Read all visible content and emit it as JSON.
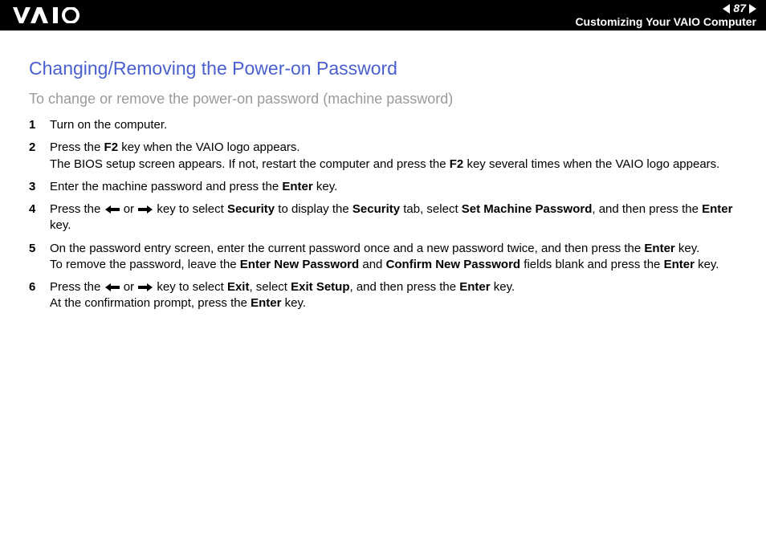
{
  "header": {
    "page_number": "87",
    "section": "Customizing Your VAIO Computer"
  },
  "page": {
    "title": "Changing/Removing the Power-on Password",
    "subtitle": "To change or remove the power-on password (machine password)"
  },
  "steps": [
    {
      "num": "1",
      "segments": [
        {
          "t": "Turn on the computer."
        }
      ]
    },
    {
      "num": "2",
      "segments": [
        {
          "t": "Press the "
        },
        {
          "b": "F2"
        },
        {
          "t": " key when the VAIO logo appears."
        },
        {
          "br": true
        },
        {
          "t": "The BIOS setup screen appears. If not, restart the computer and press the "
        },
        {
          "b": "F2"
        },
        {
          "t": " key several times when the VAIO logo appears."
        }
      ]
    },
    {
      "num": "3",
      "segments": [
        {
          "t": "Enter the machine password and press the "
        },
        {
          "b": "Enter"
        },
        {
          "t": " key."
        }
      ]
    },
    {
      "num": "4",
      "segments": [
        {
          "t": "Press the "
        },
        {
          "arrow": "left"
        },
        {
          "t": " or "
        },
        {
          "arrow": "right"
        },
        {
          "t": " key to select "
        },
        {
          "b": "Security"
        },
        {
          "t": " to display the "
        },
        {
          "b": "Security"
        },
        {
          "t": " tab, select "
        },
        {
          "b": "Set Machine Password"
        },
        {
          "t": ", and then press the "
        },
        {
          "b": "Enter"
        },
        {
          "t": " key."
        }
      ]
    },
    {
      "num": "5",
      "segments": [
        {
          "t": "On the password entry screen, enter the current password once and a new password twice, and then press the "
        },
        {
          "b": "Enter"
        },
        {
          "t": " key."
        },
        {
          "br": true
        },
        {
          "t": "To remove the password, leave the "
        },
        {
          "b": "Enter New Password"
        },
        {
          "t": " and "
        },
        {
          "b": "Confirm New Password"
        },
        {
          "t": " fields blank and press the "
        },
        {
          "b": "Enter"
        },
        {
          "t": " key."
        }
      ]
    },
    {
      "num": "6",
      "segments": [
        {
          "t": "Press the "
        },
        {
          "arrow": "left"
        },
        {
          "t": " or "
        },
        {
          "arrow": "right"
        },
        {
          "t": " key to select "
        },
        {
          "b": "Exit"
        },
        {
          "t": ", select "
        },
        {
          "b": "Exit Setup"
        },
        {
          "t": ", and then press the "
        },
        {
          "b": "Enter"
        },
        {
          "t": " key."
        },
        {
          "br": true
        },
        {
          "t": "At the confirmation prompt, press the "
        },
        {
          "b": "Enter"
        },
        {
          "t": " key."
        }
      ]
    }
  ]
}
